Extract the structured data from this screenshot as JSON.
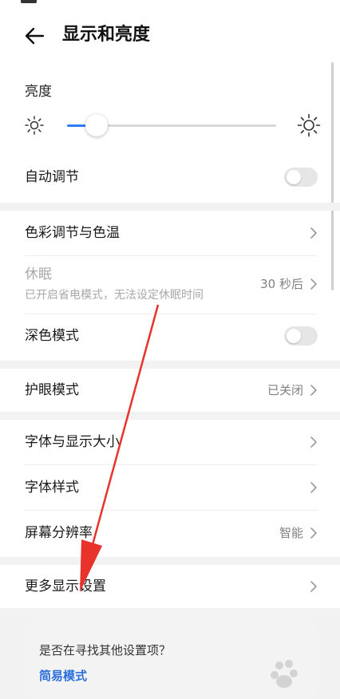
{
  "header": {
    "title": "显示和亮度"
  },
  "brightness": {
    "label": "亮度",
    "level_percent": 12
  },
  "auto_adjust": {
    "label": "自动调节",
    "enabled": false
  },
  "color": {
    "label": "色彩调节与色温"
  },
  "sleep": {
    "label": "休眠",
    "sublabel": "已开启省电模式，无法设定休眠时间",
    "value": "30 秒后"
  },
  "dark_mode": {
    "label": "深色模式",
    "enabled": false
  },
  "eye_care": {
    "label": "护眼模式",
    "value": "已关闭"
  },
  "font_size": {
    "label": "字体与显示大小"
  },
  "font_style": {
    "label": "字体样式"
  },
  "resolution": {
    "label": "屏幕分辨率",
    "value": "智能"
  },
  "more_display": {
    "label": "更多显示设置"
  },
  "suggestion": {
    "question": "是否在寻找其他设置项？",
    "link": "简易模式"
  },
  "colors": {
    "accent": "#2f7df6",
    "annotation": "#e8322c",
    "link": "#2a6fdb"
  }
}
